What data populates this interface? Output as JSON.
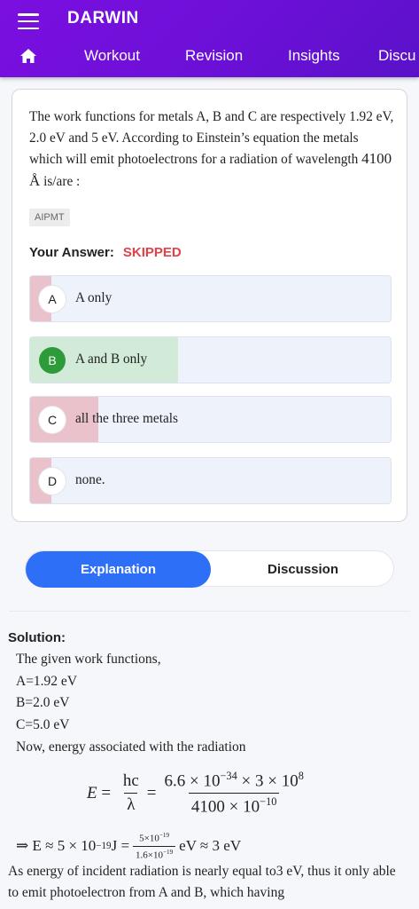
{
  "app": {
    "title": "DARWIN"
  },
  "nav": {
    "home_icon": "home-icon",
    "tabs": [
      {
        "label": "Workout"
      },
      {
        "label": "Revision"
      },
      {
        "label": "Insights"
      },
      {
        "label": "Discu"
      }
    ]
  },
  "question": {
    "text_part1": "The work functions for metals A, B and C are respectively 1.92 eV, 2.0 eV and 5 eV. According to Einstein’s equation the metals which will emit photoelectrons for a radiation of wavelength",
    "wavelength": "4100 Å",
    "text_part2": "is/are :",
    "tag": "AIPMT",
    "your_answer_label": "Your Answer:",
    "your_answer_status": "SKIPPED",
    "options": [
      {
        "letter": "A",
        "text": "A only",
        "response_fraction": 0.06,
        "fill_color": "#e9c2cb"
      },
      {
        "letter": "B",
        "text": "A and B only",
        "response_fraction": 0.41,
        "fill_color": "#d2ead8",
        "correct": true
      },
      {
        "letter": "C",
        "text": "all the three metals",
        "response_fraction": 0.19,
        "fill_color": "#e9c2cb"
      },
      {
        "letter": "D",
        "text": "none.",
        "response_fraction": 0.06,
        "fill_color": "#e9c2cb"
      }
    ]
  },
  "solution_tabs": {
    "active": "Explanation",
    "inactive": "Discussion"
  },
  "solution": {
    "heading": "Solution:",
    "lines": [
      "The given work functions,",
      "A=1.92 eV",
      "B=2.0 eV",
      "C=5.0 eV",
      "Now, energy associated with the radiation"
    ],
    "eq1": {
      "lhs": "E",
      "f1_num": "hc",
      "f1_den": "λ",
      "f2_num": "6.6 × 10",
      "f2_num_exp": "−34",
      "f2_num_tail": " × 3 × 10",
      "f2_num_tail_exp": "8",
      "f2_den": "4100 × 10",
      "f2_den_exp": "−10"
    },
    "eq2": {
      "lead": "⇒ E ≈ 5 × 10",
      "lead_exp": "−19",
      "unit": " J = ",
      "f_num": "5×10",
      "f_num_exp": "−19",
      "f_den": "1.6×10",
      "f_den_exp": "−19",
      "tail": " eV ≈ 3 eV"
    },
    "paragraph": "As energy of incident radiation is nearly equal to3 eV, thus it only able to emit photoelectron from A and B, which having"
  },
  "colors": {
    "brand": "#7b0fe0",
    "accent": "#2d6ff6",
    "skipped": "#e0414a",
    "correct": "#2e9b3a"
  }
}
